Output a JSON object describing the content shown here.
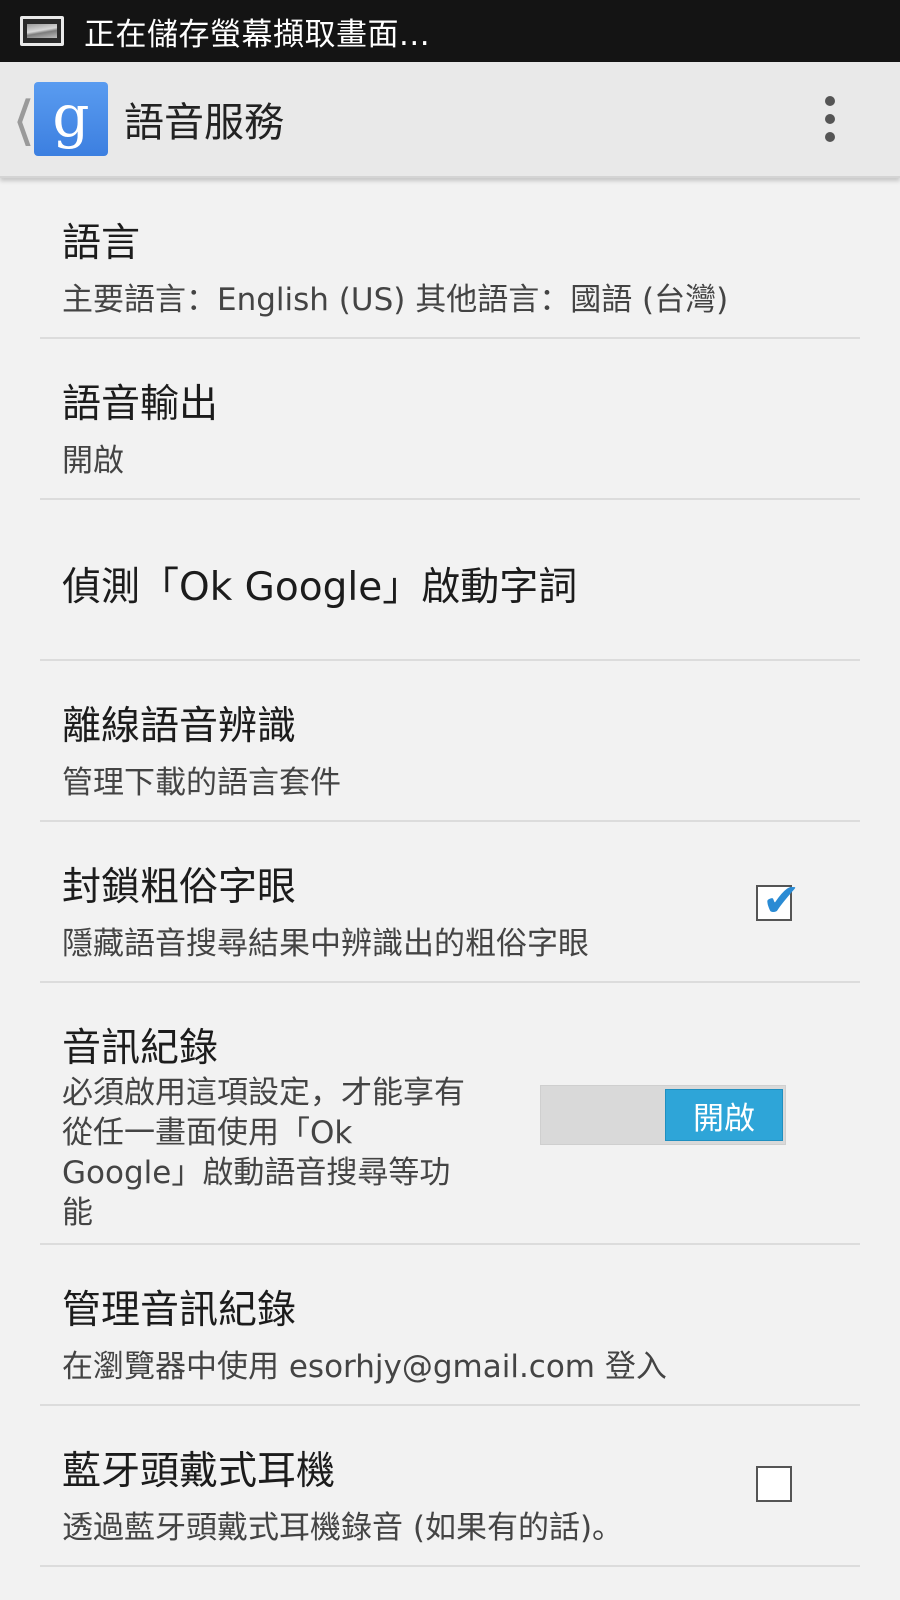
{
  "status_bar": {
    "notification_text": "正在儲存螢幕擷取畫面..."
  },
  "action_bar": {
    "up_icon": "chevron-left-icon",
    "app_icon_letter": "g",
    "title": "語音服務",
    "overflow_icon": "overflow-menu-icon"
  },
  "preferences": [
    {
      "title": "語言",
      "summary": "主要語言：English (US) 其他語言：國語 (台灣)"
    },
    {
      "title": "語音輸出",
      "summary": "開啟"
    },
    {
      "title": "偵測「Ok Google」啟動字詞"
    },
    {
      "title": "離線語音辨識",
      "summary": "管理下載的語言套件"
    },
    {
      "title": "封鎖粗俗字眼",
      "summary": "隱藏語音搜尋結果中辨識出的粗俗字眼",
      "checked": true
    },
    {
      "title": "音訊紀錄",
      "summary": "必須啟用這項設定，才能享有從任一畫面使用「Ok Google」啟動語音搜尋等功能",
      "toggle_label": "開啟"
    },
    {
      "title": "管理音訊紀錄",
      "summary": "在瀏覽器中使用 esorhjy@gmail.com 登入"
    },
    {
      "title": "藍牙頭戴式耳機",
      "summary": "透過藍牙頭戴式耳機錄音 (如果有的話)。",
      "checked": false
    }
  ],
  "colors": {
    "accent": "#2ea5d8",
    "check": "#2a8bd4",
    "app_icon": "#3c7fe0",
    "status_bar": "#141414",
    "background": "#f2f2f2"
  }
}
